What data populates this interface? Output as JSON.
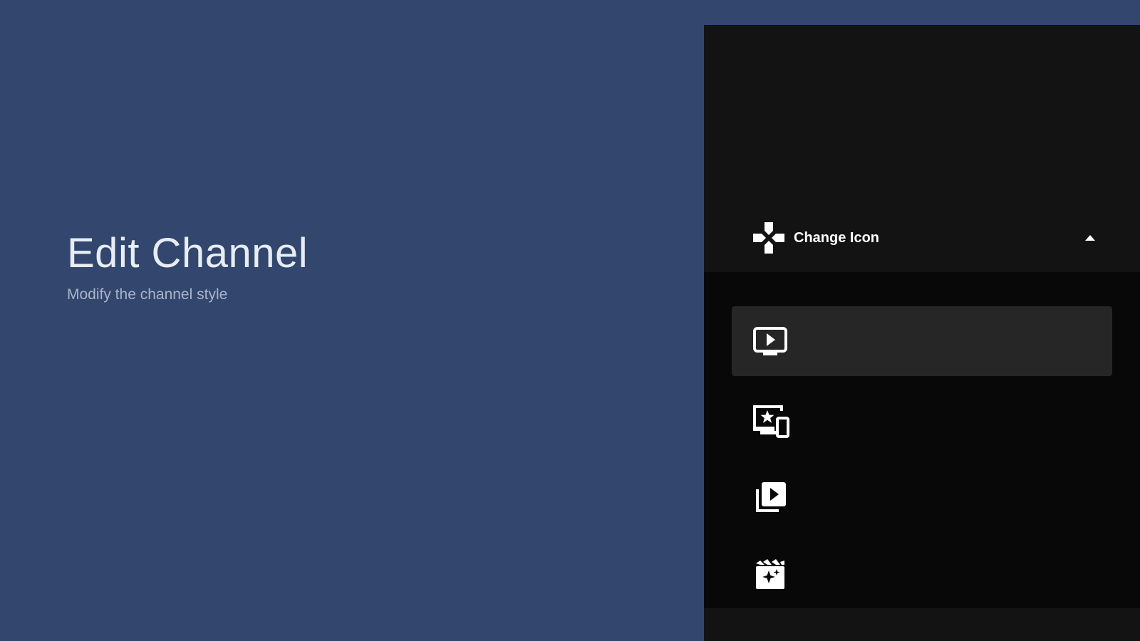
{
  "page": {
    "title": "Edit Channel",
    "subtitle": "Modify the channel style"
  },
  "panel": {
    "header_label": "Change Icon",
    "header_icon": "gamepad-icon",
    "expanded": true,
    "options": [
      {
        "icon": "tv-play-icon",
        "selected": true
      },
      {
        "icon": "devices-star-icon",
        "selected": false
      },
      {
        "icon": "video-library-icon",
        "selected": false
      },
      {
        "icon": "movie-sparkle-icon",
        "selected": false
      }
    ]
  },
  "colors": {
    "background": "#32466e",
    "panel": "#131313",
    "options_bg": "#080808",
    "selected": "#262626",
    "text": "#ffffff"
  }
}
